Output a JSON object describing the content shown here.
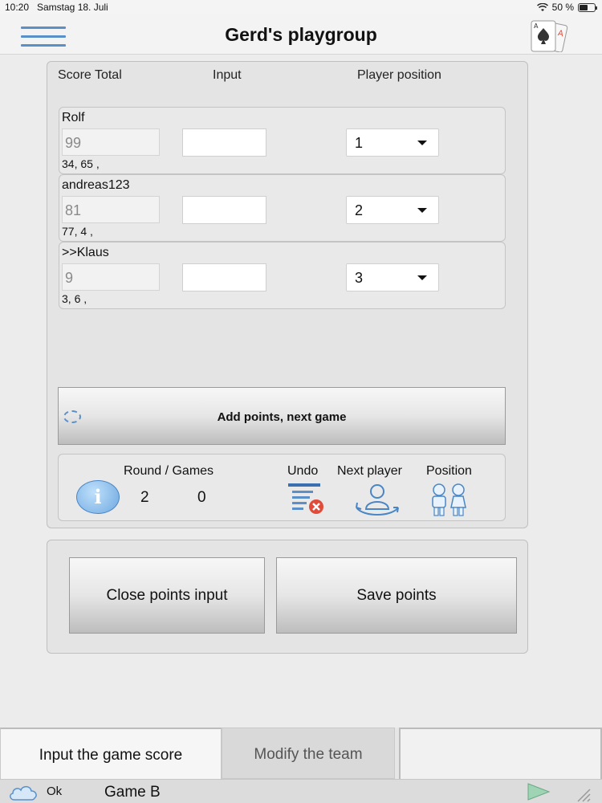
{
  "status_bar": {
    "time": "10:20",
    "date": "Samstag 18. Juli",
    "battery": "50 %"
  },
  "header": {
    "title": "Gerd's playgroup",
    "menu_icon": "hamburger-icon",
    "app_icon": "playing-cards-icon"
  },
  "columns": {
    "score_total": "Score Total",
    "input": "Input",
    "player_position": "Player position"
  },
  "players": [
    {
      "name": "Rolf",
      "score": "99",
      "history": "34, 65 ,",
      "position": "1"
    },
    {
      "name": "andreas123",
      "score": "81",
      "history": "77, 4 ,",
      "position": "2"
    },
    {
      "name": ">>Klaus",
      "score": "9",
      "history": "3, 6 ,",
      "position": "3"
    }
  ],
  "add_button": {
    "label": "Add points, next game"
  },
  "info": {
    "round_games_label": "Round / Games",
    "round": "2",
    "games": "0",
    "undo_label": "Undo",
    "next_player_label": "Next player",
    "position_label": "Position"
  },
  "actions": {
    "close_label": "Close points input",
    "save_label": "Save points"
  },
  "tabs": {
    "input_score": "Input the game score",
    "modify_team": "Modify the team"
  },
  "footer": {
    "status": "Ok",
    "game": "Game B"
  },
  "colors": {
    "accent": "#5b8fc8",
    "undo_red": "#e04b3a"
  }
}
